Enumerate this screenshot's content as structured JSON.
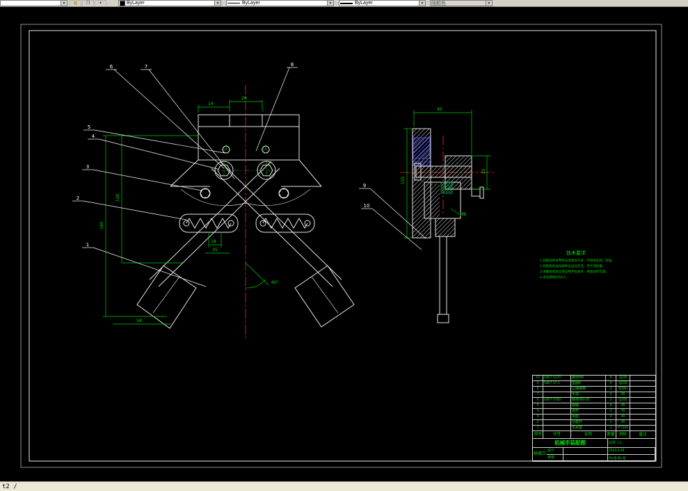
{
  "toolbar": {
    "color_value": "ByLayer",
    "linetype_value": "ByLayer",
    "lineweight_value": "ByLayer",
    "plotstyle_value": "随颜色"
  },
  "statusbar": {
    "command_text": "t2 /"
  },
  "drawing": {
    "callouts": [
      "1",
      "2",
      "3",
      "4",
      "5",
      "6",
      "7",
      "8",
      "9",
      "10"
    ],
    "dims": {
      "top_width": "28",
      "top_offset": "14",
      "left_height": "120",
      "left_total": "185",
      "bottom_left": "58",
      "spring_len": "18",
      "spring_gap": "35",
      "claw_angle": "60°",
      "side_width": "45",
      "side_left": "155",
      "side_right": "25",
      "thread": "M8"
    },
    "notes": {
      "title": "技术要求",
      "lines": [
        "1.装配前所有零件必须清洗干净，不得有毛刺、杂质。",
        "2.装配后各运动部件应运动灵活，无卡滞现象。",
        "3.弹簧安装后应保证两手指张开、夹紧动作可靠。",
        "4.未注倒角均为C1。"
      ]
    },
    "title_block": {
      "bom_header": [
        "序号",
        "代号",
        "名称",
        "数量",
        "材料",
        "备注"
      ],
      "bom_rows": [
        [
          "10",
          "GB/T 6170",
          "螺母M8",
          "4",
          "Q235",
          ""
        ],
        [
          "9",
          "GB/T 97.1",
          "垫圈8",
          "4",
          "Q235",
          ""
        ],
        [
          "8",
          "",
          "压缩弹簧",
          "2",
          "65Mn",
          ""
        ],
        [
          "7",
          "",
          "手指",
          "2",
          "45",
          ""
        ],
        [
          "6",
          "GB/T 5783",
          "螺栓M8×30",
          "2",
          "Q235",
          ""
        ],
        [
          "5",
          "",
          "销轴",
          "4",
          "45",
          ""
        ],
        [
          "4",
          "",
          "连杆",
          "2",
          "45",
          ""
        ],
        [
          "3",
          "",
          "指座",
          "2",
          "45",
          ""
        ],
        [
          "2",
          "",
          "活塞杆",
          "1",
          "45",
          ""
        ],
        [
          "1",
          "",
          "支承座",
          "1",
          "HT200",
          ""
        ]
      ],
      "title": "机械手装配图",
      "design_label": "设计",
      "check_label": "审核",
      "date": "2013.5.28",
      "school": "机械工程学院",
      "scale_label": "比例",
      "scale_value": "1:1",
      "sheet_info": "共1张 第1张"
    }
  }
}
